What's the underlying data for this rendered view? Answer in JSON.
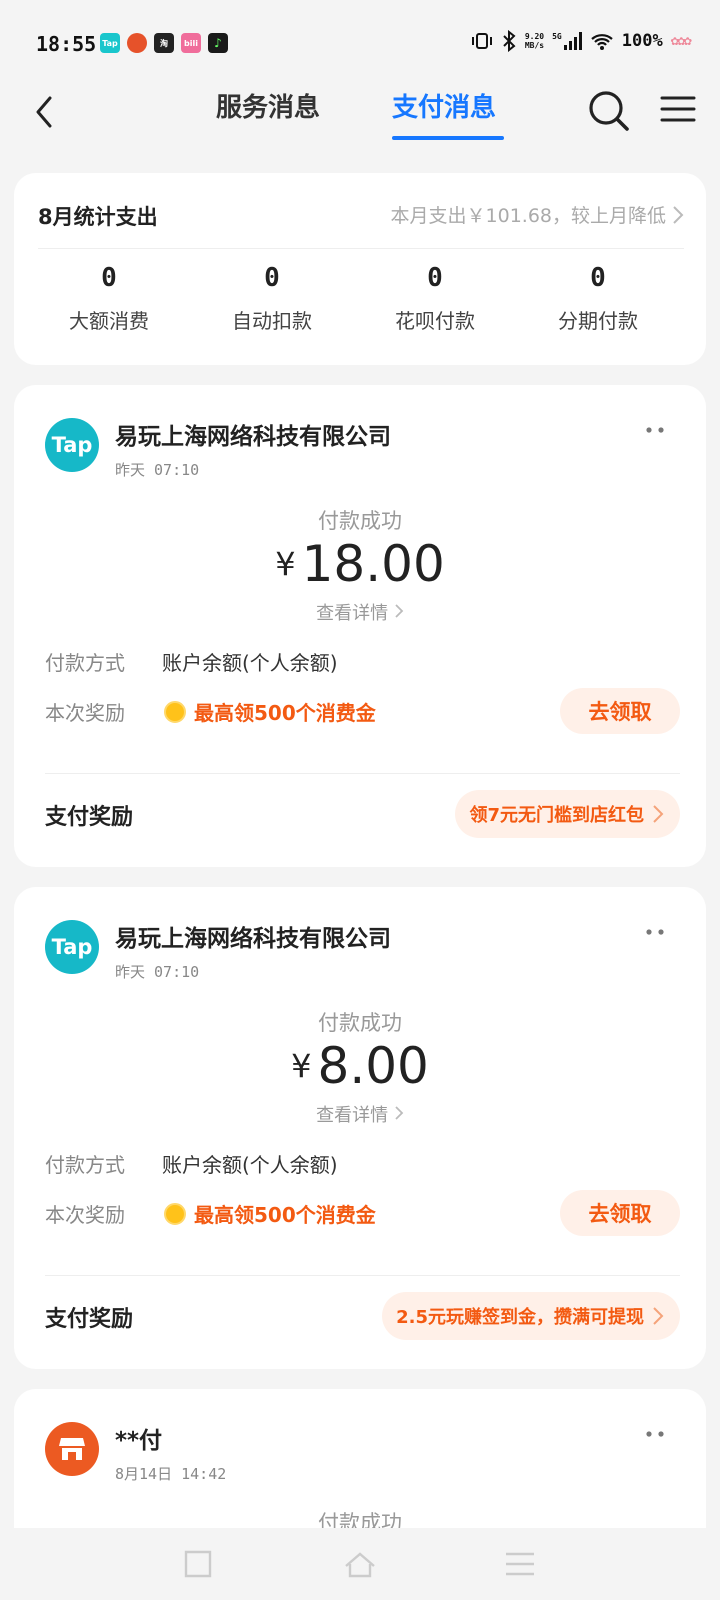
{
  "status_bar": {
    "time": "18:55",
    "apps": [
      {
        "name": "taptap-app-icon",
        "label": "Tap",
        "color": "#19c6cc"
      },
      {
        "name": "game-app-icon",
        "label": "",
        "color": "#e6522a"
      },
      {
        "name": "taobao-app-icon",
        "label": "淘",
        "color": "#222222"
      },
      {
        "name": "bilibili-app-icon",
        "label": "bili",
        "color": "#f06d9b"
      },
      {
        "name": "music-app-icon",
        "label": "",
        "color": "#1a1a1a"
      }
    ],
    "net_speed_value": "9.20",
    "net_speed_unit": "MB/s",
    "network_type": "5G",
    "battery": "100%"
  },
  "nav": {
    "tab_service": "服务消息",
    "tab_pay": "支付消息"
  },
  "summary": {
    "title": "8月统计支出",
    "month_info": "本月支出￥101.68，较上月降低",
    "stats": [
      {
        "value": "0",
        "label": "大额消费"
      },
      {
        "value": "0",
        "label": "自动扣款"
      },
      {
        "value": "0",
        "label": "花呗付款"
      },
      {
        "value": "0",
        "label": "分期付款"
      }
    ]
  },
  "payments": [
    {
      "logo_text": "Tap",
      "merchant": "易玩上海网络科技有限公司",
      "time": "昨天 07:10",
      "status": "付款成功",
      "currency": "¥",
      "amount": "18.00",
      "detail_link": "查看详情",
      "method_label": "付款方式",
      "method_value": "账户余额(个人余额)",
      "reward_label": "本次奖励",
      "reward_text": "最高领500个消费金",
      "claim_button": "去领取",
      "bonus_title": "支付奖励",
      "bonus_offer": "领7元无门槛到店红包"
    },
    {
      "logo_text": "Tap",
      "merchant": "易玩上海网络科技有限公司",
      "time": "昨天 07:10",
      "status": "付款成功",
      "currency": "¥",
      "amount": "8.00",
      "detail_link": "查看详情",
      "method_label": "付款方式",
      "method_value": "账户余额(个人余额)",
      "reward_label": "本次奖励",
      "reward_text": "最高领500个消费金",
      "claim_button": "去领取",
      "bonus_title": "支付奖励",
      "bonus_offer": "2.5元玩赚签到金，攒满可提现"
    },
    {
      "merchant": "**付",
      "time": "8月14日 14:42",
      "status": "付款成功"
    }
  ],
  "colors": {
    "accent": "#1677ff",
    "reward_orange": "#f35a12",
    "reward_bg": "#fff0e8"
  }
}
